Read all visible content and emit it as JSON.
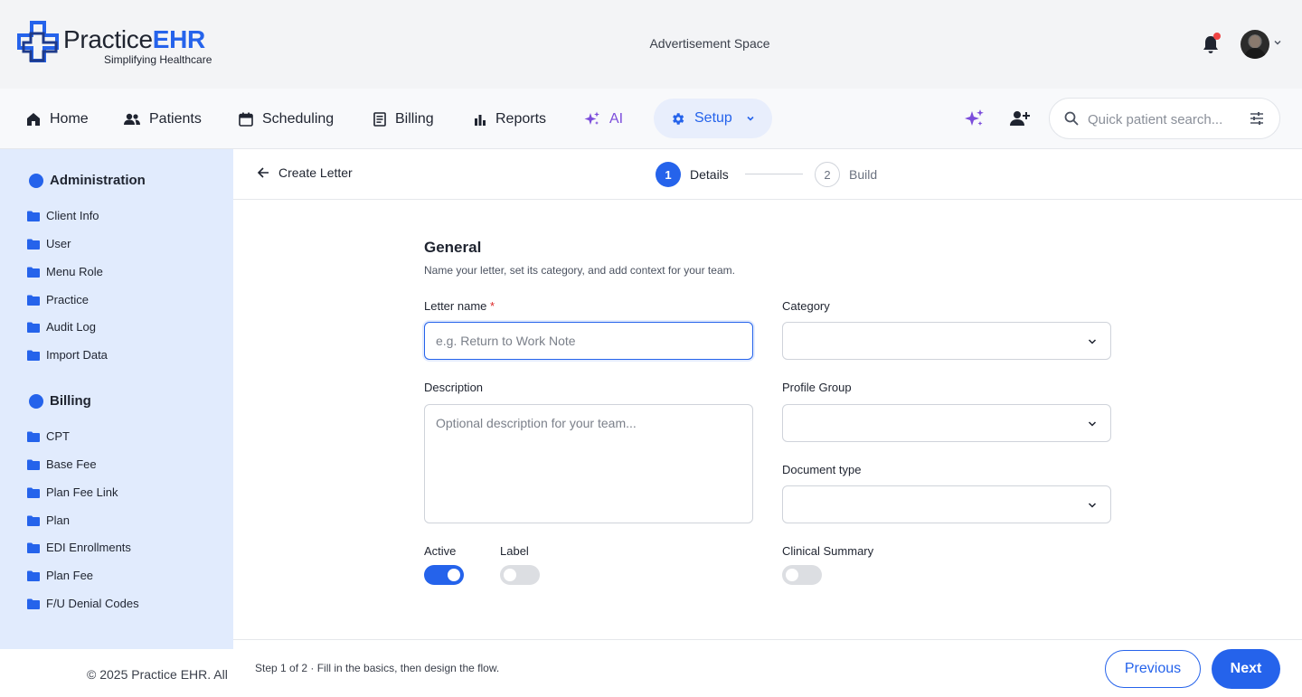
{
  "brand": {
    "name_part1": "Practice",
    "name_part2": "EHR",
    "tagline": "Simplifying Healthcare",
    "accent": "#2563eb"
  },
  "topbar": {
    "ad_text": "Advertisement Space",
    "notification_icon": "bell-icon",
    "has_unread": true
  },
  "nav": {
    "items": [
      {
        "label": "Home",
        "icon": "home-icon"
      },
      {
        "label": "Patients",
        "icon": "users-icon"
      },
      {
        "label": "Scheduling",
        "icon": "calendar-icon"
      },
      {
        "label": "Billing",
        "icon": "receipt-icon"
      },
      {
        "label": "Reports",
        "icon": "bar-chart-icon"
      },
      {
        "label": "AI",
        "icon": "sparkles-icon"
      },
      {
        "label": "Setup",
        "icon": "gear-icon"
      }
    ],
    "active": "Setup",
    "search_placeholder": "Quick patient search..."
  },
  "sidebar": {
    "sections": [
      {
        "title": "Administration",
        "items": [
          "Client Info",
          "User",
          "Menu Role",
          "Practice",
          "Audit Log",
          "Import Data"
        ]
      },
      {
        "title": "Billing",
        "items": [
          "CPT",
          "Base Fee",
          "Plan Fee Link",
          "Plan",
          "EDI Enrollments",
          "Plan Fee",
          "F/U Denial Codes"
        ]
      }
    ]
  },
  "header": {
    "back_label": "Create Letter",
    "steps": [
      {
        "number": "1",
        "label": "Details",
        "active": true
      },
      {
        "number": "2",
        "label": "Build",
        "active": false
      }
    ]
  },
  "form": {
    "title": "General",
    "subtitle": "Name your letter, set its category, and add context for your team.",
    "letter_name": {
      "label": "Letter name",
      "required_mark": "*",
      "value": "",
      "placeholder": "e.g. Return to Work Note"
    },
    "category": {
      "label": "Category",
      "value": ""
    },
    "description": {
      "label": "Description",
      "value": "",
      "placeholder": "Optional description for your team..."
    },
    "profile_group": {
      "label": "Profile Group",
      "value": ""
    },
    "document_type": {
      "label": "Document type",
      "value": ""
    },
    "toggles": {
      "active": {
        "label": "Active",
        "on": true
      },
      "label": {
        "label": "Label",
        "on": false
      },
      "clinical_summary": {
        "label": "Clinical Summary",
        "on": false
      }
    }
  },
  "footer": {
    "copyright": "© 2025 Practice EHR. All",
    "step_hint": "Step 1 of 2 · Fill in the basics, then design the flow.",
    "previous_label": "Previous",
    "next_label": "Next"
  }
}
